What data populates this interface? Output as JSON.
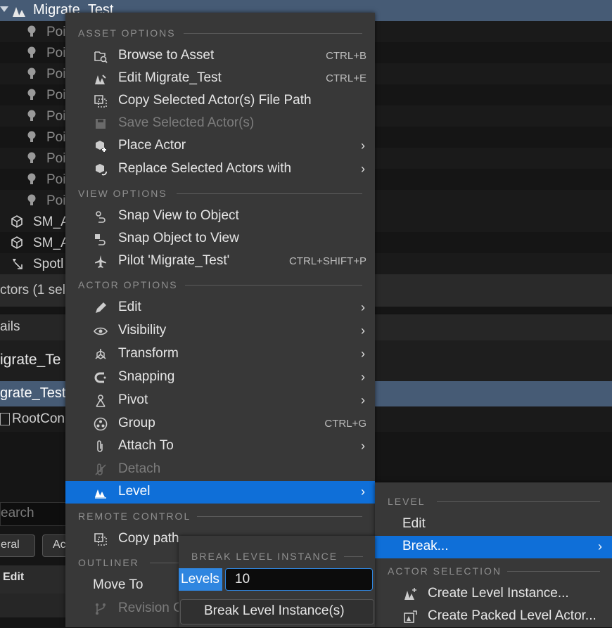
{
  "outliner": {
    "top_title": "Migrate_Test",
    "rows": [
      {
        "label": "Poi"
      },
      {
        "label": "Poi"
      },
      {
        "label": "Poi"
      },
      {
        "label": "Poi"
      },
      {
        "label": "Poi"
      },
      {
        "label": "Poi"
      },
      {
        "label": "Poi"
      },
      {
        "label": "Poi"
      },
      {
        "label": "Poi"
      }
    ],
    "mesh_rows": [
      {
        "label": "SM_A"
      },
      {
        "label": "SM_A"
      },
      {
        "label": "Spotl"
      }
    ],
    "actors_status": "ctors (1 sel",
    "details_tab": "ails",
    "details_name": "igrate_Te",
    "details_sel": "grate_Test",
    "root_component": "RootCon",
    "search_placeholder": "earch",
    "filter_general": "eral",
    "filter_ac": "Ac",
    "edit_label": "Edit"
  },
  "menu": {
    "asset_options": "ASSET OPTIONS",
    "browse_to_asset": "Browse to Asset",
    "browse_shortcut": "CTRL+B",
    "edit_migrate": "Edit Migrate_Test",
    "edit_shortcut": "CTRL+E",
    "copy_path": "Copy Selected Actor(s) File Path",
    "save_selected": "Save Selected Actor(s)",
    "place_actor": "Place Actor",
    "replace_selected": "Replace Selected Actors with",
    "view_options": "VIEW OPTIONS",
    "snap_view": "Snap View to Object",
    "snap_object": "Snap Object to View",
    "pilot": "Pilot 'Migrate_Test'",
    "pilot_shortcut": "CTRL+SHIFT+P",
    "actor_options": "ACTOR OPTIONS",
    "edit": "Edit",
    "visibility": "Visibility",
    "transform": "Transform",
    "snapping": "Snapping",
    "pivot": "Pivot",
    "group": "Group",
    "group_shortcut": "CTRL+G",
    "attach_to": "Attach To",
    "detach": "Detach",
    "level": "Level",
    "remote_control": "REMOTE CONTROL",
    "copy_path_rc": "Copy path",
    "outliner": "OUTLINER",
    "move_to": "Move To",
    "revision": "Revision C"
  },
  "level_submenu": {
    "header": "LEVEL",
    "edit": "Edit",
    "break": "Break...",
    "actor_selection": "ACTOR SELECTION",
    "create_level_instance": "Create Level Instance...",
    "create_packed": "Create Packed Level Actor..."
  },
  "break_popup": {
    "header": "BREAK LEVEL INSTANCE",
    "levels_label": "Levels",
    "levels_value": "10",
    "button": "Break Level Instance(s)"
  },
  "colors": {
    "accent": "#0f6fd8",
    "menu_bg": "#383838",
    "header_bar": "#465b75"
  }
}
